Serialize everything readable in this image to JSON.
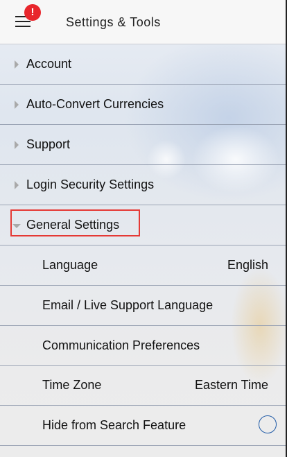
{
  "header": {
    "title": "Settings & Tools",
    "badge": "!"
  },
  "sections": [
    {
      "label": "Account"
    },
    {
      "label": "Auto-Convert Currencies"
    },
    {
      "label": "Support"
    },
    {
      "label": "Login Security Settings"
    },
    {
      "label": "General Settings"
    }
  ],
  "general_settings": {
    "language": {
      "label": "Language",
      "value": "English"
    },
    "support_language": {
      "label": "Email / Live Support Language"
    },
    "communication": {
      "label": "Communication Preferences"
    },
    "time_zone": {
      "label": "Time Zone",
      "value": "Eastern Time"
    },
    "hide_search": {
      "label": "Hide from Search Feature",
      "checked": false
    }
  },
  "colors": {
    "badge": "#e8262c",
    "highlight_border": "#e53935",
    "radio_border": "#1f5aa6"
  }
}
